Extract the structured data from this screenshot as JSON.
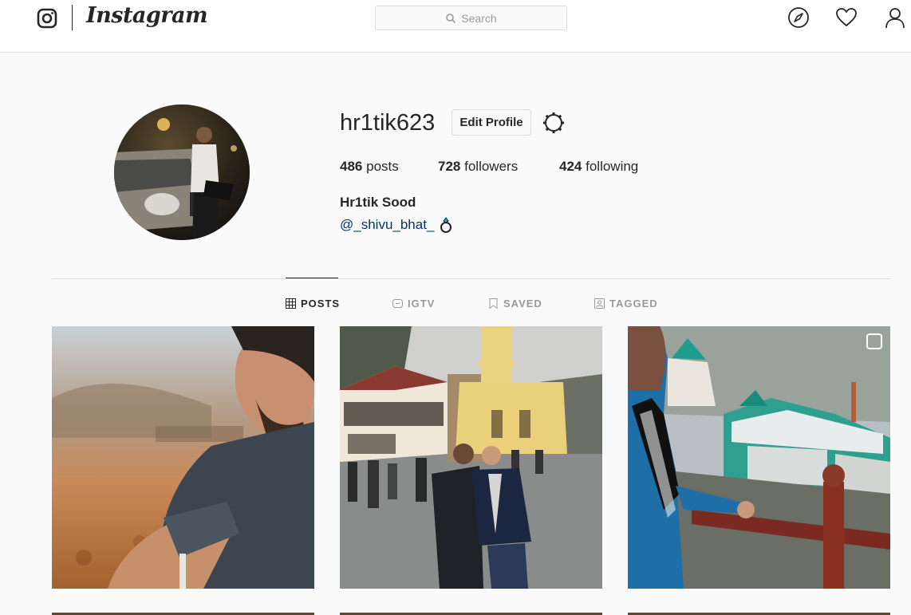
{
  "nav": {
    "wordmark": "Instagram",
    "search_placeholder": "Search"
  },
  "profile": {
    "username": "hr1tik623",
    "edit_label": "Edit Profile",
    "posts_count": "486",
    "posts_label": "posts",
    "followers_count": "728",
    "followers_label": "followers",
    "following_count": "424",
    "following_label": "following",
    "full_name": "Hr1tik Sood",
    "bio_mention": "@_shivu_bhat_"
  },
  "tabs": [
    {
      "label": "POSTS",
      "icon": "grid-icon",
      "active": true
    },
    {
      "label": "IGTV",
      "icon": "igtv-icon",
      "active": false
    },
    {
      "label": "SAVED",
      "icon": "bookmark-icon",
      "active": false
    },
    {
      "label": "TAGGED",
      "icon": "tag-icon",
      "active": false
    }
  ],
  "colors": {
    "link": "#003569",
    "border": "#dbdbdb",
    "background": "#fafafa"
  }
}
